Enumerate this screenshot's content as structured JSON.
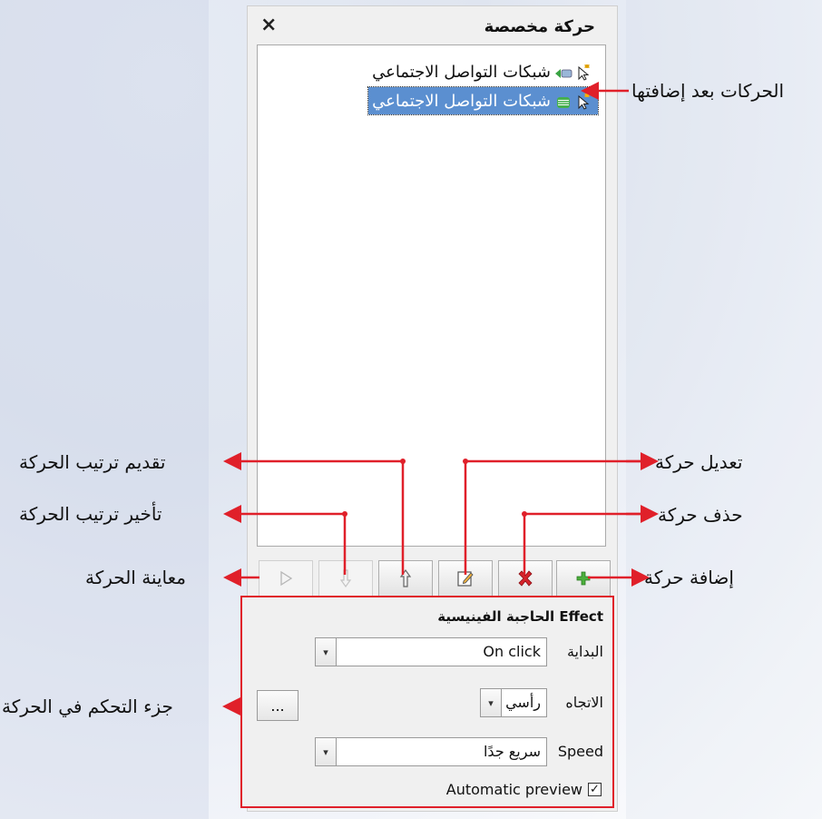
{
  "panel": {
    "title": "حركة مخصصة",
    "close_glyph": "×",
    "items": [
      {
        "label": "شبكات التواصل الاجتماعي",
        "selected": false,
        "icon": "cursor-star-icon"
      },
      {
        "label": "شبكات التواصل الاجتماعي",
        "selected": true,
        "icon": "cursor-star-icon"
      }
    ],
    "toolbar": [
      {
        "name": "add-animation-button",
        "icon": "plus-icon",
        "enabled": true
      },
      {
        "name": "remove-animation-button",
        "icon": "delete-x-icon",
        "enabled": true
      },
      {
        "name": "edit-animation-button",
        "icon": "edit-icon",
        "enabled": true
      },
      {
        "name": "move-up-button",
        "icon": "arrow-up-icon",
        "enabled": true
      },
      {
        "name": "move-down-button",
        "icon": "arrow-down-icon",
        "enabled": false
      },
      {
        "name": "play-button",
        "icon": "play-icon",
        "enabled": false
      }
    ]
  },
  "controls": {
    "effect_title": "Effect الحاجبة الفينيسية",
    "start_label": "البداية",
    "start_value": "On click",
    "direction_label": "الاتجاه",
    "direction_value": "رأسي",
    "speed_label": "Speed",
    "speed_value": "سريع جدًا",
    "more_button": "...",
    "auto_preview_label": "Automatic preview",
    "auto_preview_checked": true
  },
  "callouts": {
    "added": "الحركات بعد إضافتها",
    "edit": "تعديل حركة",
    "delete": "حذف حركة",
    "add": "إضافة حركة",
    "move_up": "تقديم ترتيب الحركة",
    "move_down": "تأخير ترتيب الحركة",
    "preview": "معاينة الحركة",
    "control_part": "جزء التحكم في الحركة"
  },
  "colors": {
    "callout_arrow": "#e0202a",
    "selection": "#5b8fd0",
    "highlight_box": "#e0202a"
  }
}
